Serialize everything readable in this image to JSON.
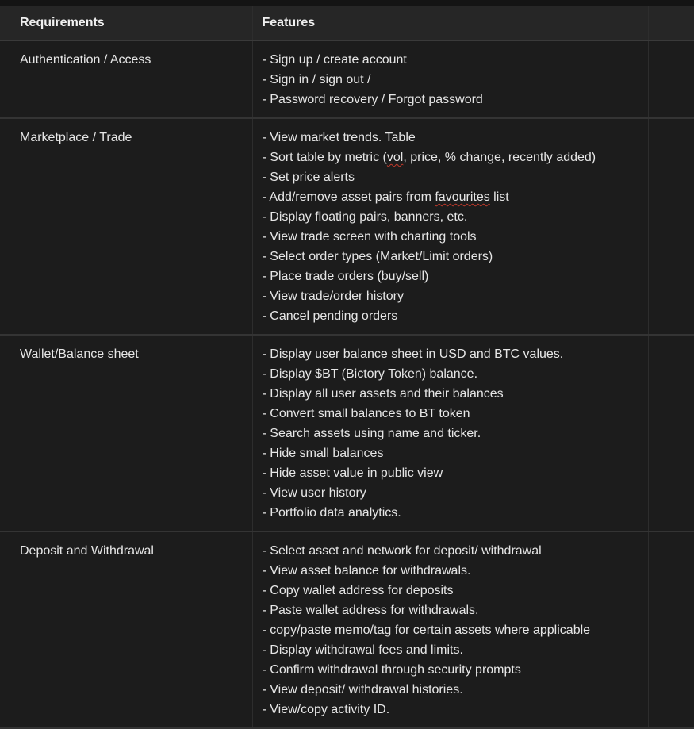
{
  "table": {
    "headers": [
      "Requirements",
      "Features",
      ""
    ],
    "rows": [
      {
        "requirement": "Authentication / Access",
        "features": [
          "- Sign up / create account",
          "- Sign in / sign out /",
          "- Password recovery / Forgot password"
        ]
      },
      {
        "requirement": "Marketplace / Trade",
        "features": [
          "- View market trends. Table",
          "- Sort table by metric (vol, price, % change, recently added)",
          "- Set price alerts",
          "- Add/remove asset pairs from favourites list",
          "- Display floating pairs, banners, etc.",
          "- View trade screen with charting tools",
          "- Select order types (Market/Limit orders)",
          "- Place trade orders (buy/sell)",
          "- View trade/order history",
          "- Cancel pending orders"
        ]
      },
      {
        "requirement": "Wallet/Balance sheet",
        "features": [
          "- Display user balance sheet in USD and BTC values.",
          "- Display $BT (Bictory Token) balance.",
          "- Display all user assets and their balances",
          "- Convert small balances to BT token",
          "- Search assets using name and ticker.",
          "- Hide small balances",
          "- Hide asset value in public view",
          "- View user history",
          "- Portfolio data analytics."
        ]
      },
      {
        "requirement": "Deposit and Withdrawal",
        "features": [
          "- Select asset and network for deposit/ withdrawal",
          "- View asset balance for withdrawals.",
          "- Copy wallet address for deposits",
          "- Paste wallet address for withdrawals.",
          "- copy/paste memo/tag for certain assets where applicable",
          "- Display withdrawal fees and limits.",
          "- Confirm withdrawal through security prompts",
          "- View deposit/ withdrawal histories.",
          "- View/copy activity ID."
        ]
      }
    ]
  }
}
